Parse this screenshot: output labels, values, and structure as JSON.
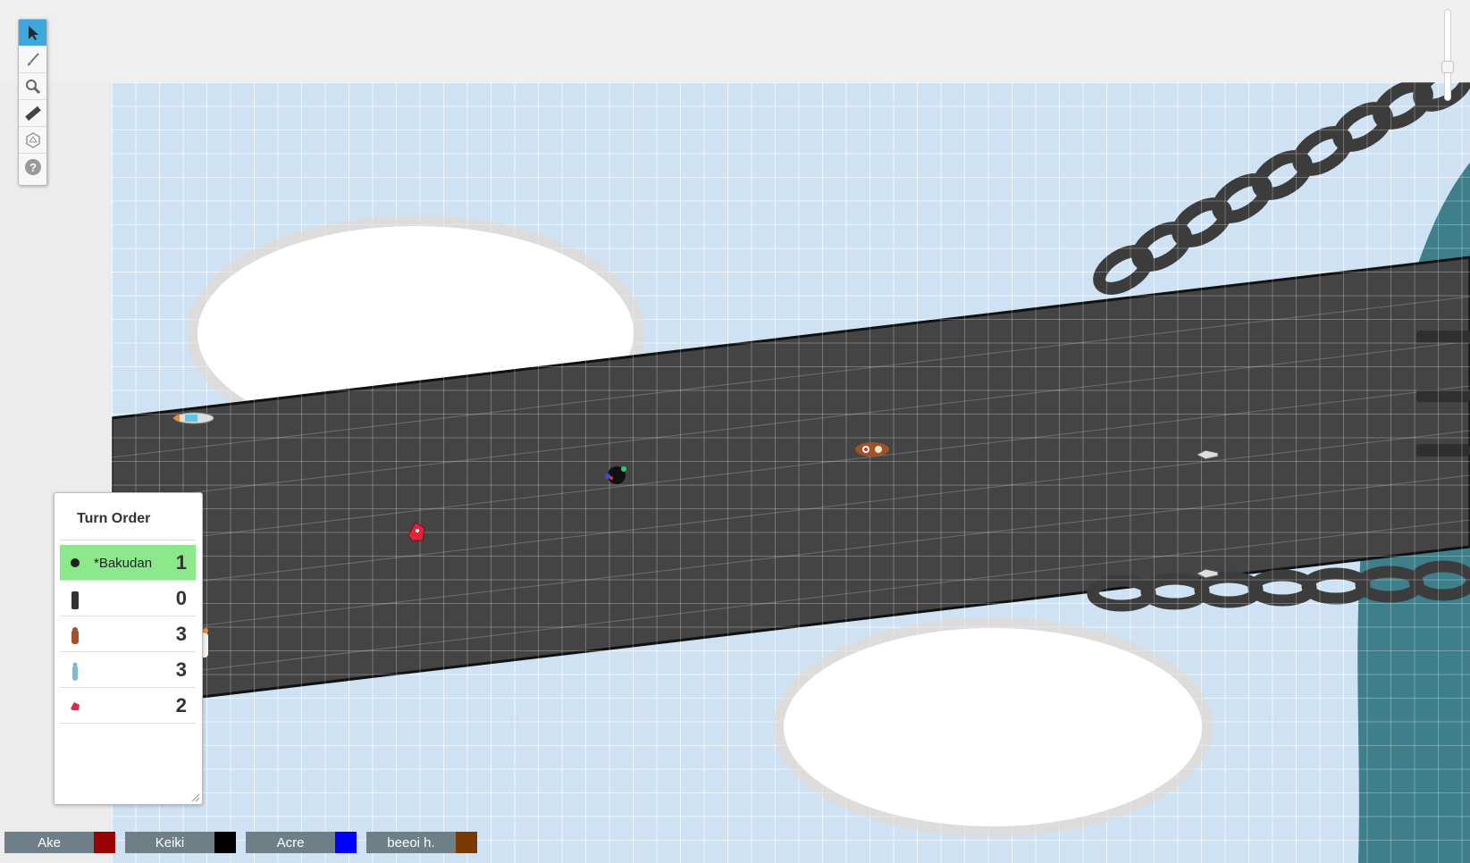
{
  "toolbar": {
    "tools": [
      {
        "name": "select-tool",
        "icon": "pointer-icon",
        "active": true
      },
      {
        "name": "draw-tool",
        "icon": "brush-icon",
        "active": false
      },
      {
        "name": "zoom-tool",
        "icon": "magnifier-icon",
        "active": false
      },
      {
        "name": "measure-tool",
        "icon": "ruler-icon",
        "active": false
      },
      {
        "name": "dice-tool",
        "icon": "d20-icon",
        "active": false
      },
      {
        "name": "help-tool",
        "icon": "question-icon",
        "active": false
      }
    ]
  },
  "turn_order": {
    "title": "Turn Order",
    "entries": [
      {
        "name": "*Bakudan",
        "initiative": "1",
        "current": true,
        "icon_color": "#222222"
      },
      {
        "name": "",
        "initiative": "0",
        "current": false,
        "icon_color": "#333333"
      },
      {
        "name": "",
        "initiative": "3",
        "current": false,
        "icon_color": "#a0522d"
      },
      {
        "name": "",
        "initiative": "3",
        "current": false,
        "icon_color": "#7fb8d8"
      },
      {
        "name": "",
        "initiative": "2",
        "current": false,
        "icon_color": "#d0304a"
      }
    ]
  },
  "players": [
    {
      "name": "Ake",
      "color": "#990000"
    },
    {
      "name": "Keiki",
      "color": "#000000"
    },
    {
      "name": "Acre",
      "color": "#0000ff"
    },
    {
      "name": "beeoi h.",
      "color": "#7a3a00"
    }
  ],
  "colors": {
    "map_background": "#cfe2f3",
    "bridge": "#444444",
    "water": "#3f7f8c",
    "chain": "#3c3c3c",
    "active_tool": "#3ea8dc",
    "current_turn": "#8be88b"
  }
}
